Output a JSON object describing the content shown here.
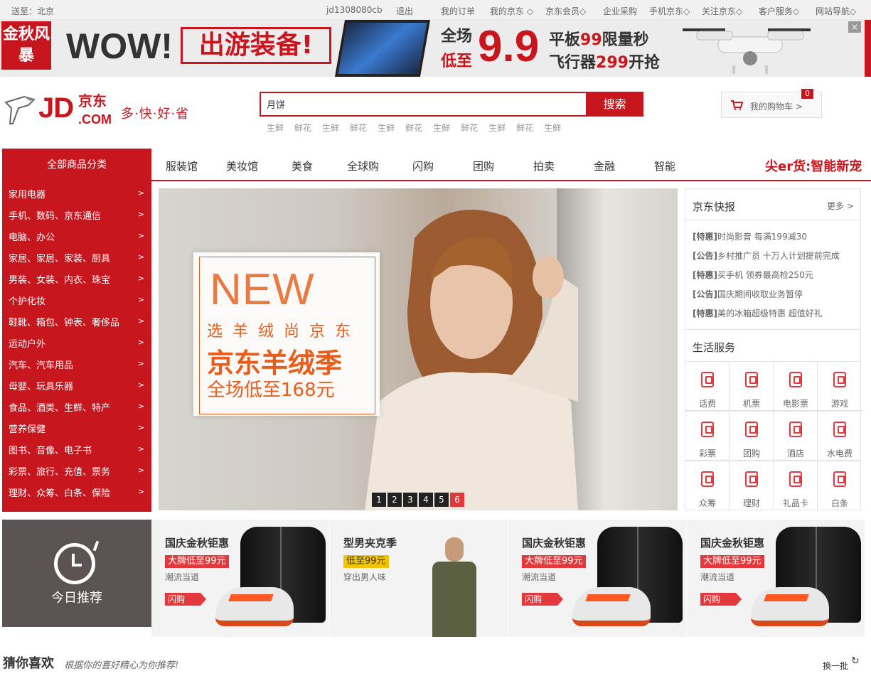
{
  "topbar": {
    "location": "送至：北京",
    "username": "jd1308080cb",
    "logout": "退出",
    "links": [
      "我的订单",
      "我的京东 ◇",
      "京东会员◇",
      "企业采购",
      "手机京东◇",
      "关注京东◇",
      "客户服务◇",
      "网站导航◇"
    ]
  },
  "promo": {
    "badge": "金秋风暴",
    "wow": "WOW!",
    "headline": "出游装备!",
    "quanchang": "全场",
    "dizhi": "低至",
    "price": "9.9",
    "line1_a": "平板",
    "line1_b": "99",
    "line1_c": "限量秒",
    "line2_a": "飞行器",
    "line2_b": "299",
    "line2_c": "开抢",
    "close": "×"
  },
  "header": {
    "logo_jd": "JD",
    "logo_cn": "京东",
    "logo_com": ".COM",
    "slogan": "多·快·好·省",
    "search_value": "月饼",
    "search_button": "搜索",
    "hotwords": [
      "生鲜",
      "鲜花",
      "生鲜",
      "鲜花",
      "生鲜",
      "鲜花",
      "生鲜",
      "鲜花",
      "生鲜",
      "鲜花",
      "生鲜"
    ],
    "cart_label": "我的购物车 >",
    "cart_count": "0"
  },
  "nav": {
    "all_categories": "全部商品分类",
    "items": [
      "服装馆",
      "美妆馆",
      "美食",
      "全球购",
      "闪购",
      "团购",
      "拍卖",
      "金融",
      "智能"
    ],
    "slogan": "尖er货:智能新宠"
  },
  "categories": [
    "家用电器",
    "手机、数码、京东通信",
    "电脑、办公",
    "家居、家居、家装、厨具",
    "男装、女装、内衣、珠宝",
    "个护化妆",
    "鞋靴、箱包、钟表、奢侈品",
    "运动户外",
    "汽车、汽车用品",
    "母婴、玩具乐器",
    "食品、酒类、生鲜、特产",
    "营养保健",
    "图书、音像、电子书",
    "彩票、旅行、充值、票务",
    "理财、众筹、白条、保险"
  ],
  "carousel": {
    "new": "NEW",
    "subtitle": "选羊绒尚京东",
    "title": "京东羊绒季",
    "price_line": "全场低至168元",
    "dots": [
      "1",
      "2",
      "3",
      "4",
      "5",
      "6"
    ],
    "active_dot": 6
  },
  "news": {
    "title": "京东快报",
    "more": "更多 >",
    "items": [
      {
        "tag": "[特惠]",
        "text": "时尚影音 每满199减30"
      },
      {
        "tag": "[公告]",
        "text": "乡村推广员 十万人计划提前完成"
      },
      {
        "tag": "[特惠]",
        "text": "买手机 领券最高检250元"
      },
      {
        "tag": "[公告]",
        "text": "国庆期间收取业务暂停"
      },
      {
        "tag": "[特惠]",
        "text": "美的冰箱超级特惠 超值好礼"
      }
    ],
    "services_title": "生活服务",
    "services": [
      "话费",
      "机票",
      "电影票",
      "游戏",
      "彩票",
      "团购",
      "酒店",
      "水电费",
      "众筹",
      "理财",
      "礼品卡",
      "白条"
    ]
  },
  "today": {
    "label": "今日推荐"
  },
  "recommendations": [
    {
      "title": "国庆金秋钜惠",
      "tag": "大牌低至99元",
      "sub": "潮流当道",
      "buy": "闪购",
      "kind": "jacket"
    },
    {
      "title": "型男夹克季",
      "tag": "低至99元",
      "sub": "穿出男人味",
      "buy": "",
      "kind": "man"
    },
    {
      "title": "国庆金秋钜惠",
      "tag": "大牌低至99元",
      "sub": "潮流当道",
      "buy": "闪购",
      "kind": "jacket"
    },
    {
      "title": "国庆金秋钜惠",
      "tag": "大牌低至99元",
      "sub": "潮流当道",
      "buy": "闪购",
      "kind": "jacket"
    }
  ],
  "guess": {
    "title": "猜你喜欢",
    "subtitle": "根据你的喜好精心为你推荐!",
    "refresh": "换一批"
  }
}
